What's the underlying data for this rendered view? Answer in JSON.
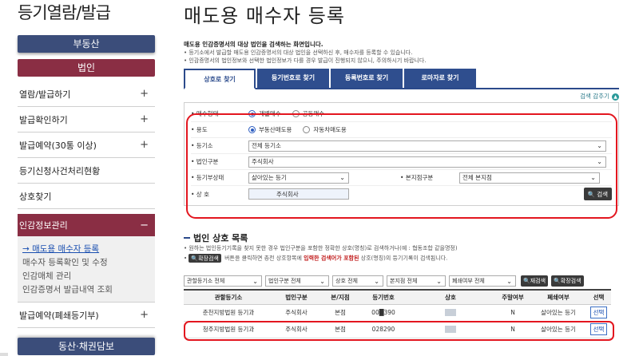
{
  "header": {
    "section_title": "등기열람/발급",
    "page_title": "매도용 매수자 등록"
  },
  "sidebar": {
    "top_buttons": [
      "부동산",
      "법인"
    ],
    "items": [
      {
        "label": "열람/발급하기",
        "plus": "+"
      },
      {
        "label": "발급확인하기",
        "plus": "+"
      },
      {
        "label": "발급예약(30통 이상)",
        "plus": "+"
      },
      {
        "label": "등기신청사건처리현황",
        "plus": ""
      },
      {
        "label": "상호찾기",
        "plus": ""
      },
      {
        "label": "인감정보관리",
        "plus": "−"
      }
    ],
    "sub_items": [
      "→ 매도용 매수자 등록",
      "매수자 등록확인 및 수정",
      "인감매체 관리",
      "인감증명서 발급내역 조회"
    ],
    "after_items": [
      {
        "label": "발급예약(폐쇄등기부)",
        "plus": "+"
      }
    ],
    "bottom_button": "동산·채권담보"
  },
  "intro": {
    "title": "매도용 인감증명서의 대상 법인을 검색하는 화면입니다.",
    "lines": [
      "• 등기소에서 발급할 매도용 인감증명서의 대상 법인을 선택하신 후, 매수자를 등록할 수 있습니다.",
      "• 인감증명서의 법인정보와 선택한 법인정보가 다를 경우 발급이 진행되지 않으니, 주의하시기 바랍니다."
    ]
  },
  "tabs": [
    "상호로 찾기",
    "등기번호로 찾기",
    "등록번호로 찾기",
    "로마자로 찾기"
  ],
  "search_toggle": "검색 감추기",
  "form": {
    "trade_type": {
      "label": "• 매수형태",
      "options": [
        "개별매수",
        "공동매수"
      ],
      "selected": "개별매수"
    },
    "purpose": {
      "label": "• 용도",
      "options": [
        "부동산매도용",
        "자동차매도용"
      ],
      "selected": "부동산매도용"
    },
    "registry_office": {
      "label": "• 등기소",
      "value": "전체 등기소"
    },
    "corp_type": {
      "label": "• 법인구분",
      "value": "주식회사"
    },
    "registry_status": {
      "label": "• 등기부상태",
      "value": "살아있는 등기"
    },
    "branch_type": {
      "label": "• 본지점구분",
      "value": "전체 본지점"
    },
    "trade_name": {
      "label": "• 상 호",
      "value": "주식회사"
    },
    "search_button": "검색"
  },
  "results_section": {
    "title": "법인 상호 목록",
    "note1": "• 원하는 법인등기기록을 찾지 못한 경우 법인구분을 포함한 정확한 상호(명칭)로 검색하거나(예 : 협동조합 같을명정)",
    "note2_pre": "버튼을 클릭하면 총전 상호항목에",
    "note2_red": "입력한 검색어가 포함된",
    "note2_post": "상호(명칭)의 등기기록이 검색됩니다.",
    "expand_button": "확장검색",
    "filters": [
      "관할등기소 전체",
      "법인구분 전체",
      "상호 전체",
      "본지점 전체",
      "폐쇄여부 전체"
    ],
    "research_button": "재검색",
    "expand_search_button": "확장검색",
    "columns": [
      "관할등기소",
      "법인구분",
      "본/지점",
      "등기번호",
      "상호",
      "주말여부",
      "폐쇄여부",
      "선택"
    ],
    "rows": [
      {
        "office": "춘천지방법원 등기과",
        "corp_type": "주식회사",
        "branch": "본점",
        "reg_no": "00█390",
        "name": "",
        "weekend": "N",
        "status": "살아있는 등기",
        "select": "선택"
      },
      {
        "office": "청주지방법원 등기과",
        "corp_type": "주식회사",
        "branch": "본점",
        "reg_no": "028290",
        "name": "",
        "weekend": "N",
        "status": "살아있는 등기",
        "select": "선택"
      }
    ]
  },
  "colors": {
    "nav_dark": "#3b4d7a",
    "active": "#8a2e44",
    "tab_blue": "#2f4e8e",
    "highlight_red": "#e3161f"
  }
}
